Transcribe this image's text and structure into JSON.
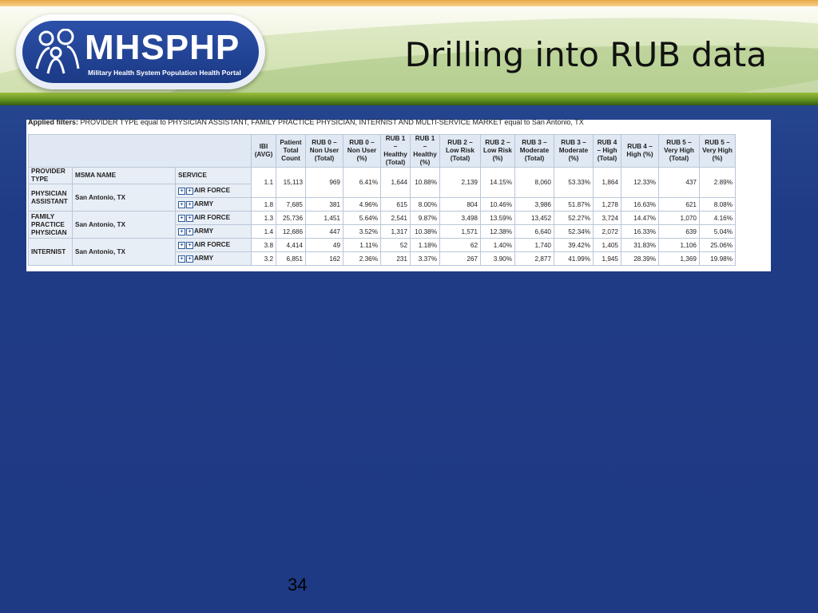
{
  "slide": {
    "title": "Drilling into RUB data",
    "page_number": "34"
  },
  "logo": {
    "brand": "MHSPHP",
    "tagline": "Military Health System Population Health Portal"
  },
  "filters": {
    "label": "Applied filters:",
    "text": "PROVIDER TYPE equal to PHYSICIAN ASSISTANT, FAMILY PRACTICE PHYSICIAN, INTERNIST AND MULTI-SERVICE MARKET equal to San Antonio, TX"
  },
  "table": {
    "dimension_headers": [
      "PROVIDER TYPE",
      "MSMA NAME",
      "SERVICE"
    ],
    "metric_headers": [
      "IBI (AVG)",
      "Patient Total Count",
      "RUB 0 – Non User (Total)",
      "RUB 0 – Non User (%)",
      "RUB 1 – Healthy (Total)",
      "RUB 1 – Healthy (%)",
      "RUB 2 – Low Risk (Total)",
      "RUB 2 – Low Risk (%)",
      "RUB 3 – Moderate (Total)",
      "RUB 3 – Moderate (%)",
      "RUB 4 – High (Total)",
      "RUB 4 – High (%)",
      "RUB 5 – Very High (Total)",
      "RUB 5 – Very High (%)"
    ],
    "groups": [
      {
        "provider_type": "PHYSICIAN ASSISTANT",
        "msma": "San Antonio, TX",
        "rows": [
          {
            "service": "AIR FORCE",
            "values": [
              "1.1",
              "15,113",
              "969",
              "6.41%",
              "1,644",
              "10.88%",
              "2,139",
              "14.15%",
              "8,060",
              "53.33%",
              "1,864",
              "12.33%",
              "437",
              "2.89%"
            ]
          },
          {
            "service": "ARMY",
            "values": [
              "1.8",
              "7,685",
              "381",
              "4.96%",
              "615",
              "8.00%",
              "804",
              "10.46%",
              "3,986",
              "51.87%",
              "1,278",
              "16.63%",
              "621",
              "8.08%"
            ]
          }
        ]
      },
      {
        "provider_type": "FAMILY PRACTICE PHYSICIAN",
        "msma": "San Antonio, TX",
        "rows": [
          {
            "service": "AIR FORCE",
            "values": [
              "1.3",
              "25,736",
              "1,451",
              "5.64%",
              "2,541",
              "9.87%",
              "3,498",
              "13.59%",
              "13,452",
              "52.27%",
              "3,724",
              "14.47%",
              "1,070",
              "4.16%"
            ]
          },
          {
            "service": "ARMY",
            "values": [
              "1.4",
              "12,686",
              "447",
              "3.52%",
              "1,317",
              "10.38%",
              "1,571",
              "12.38%",
              "6,640",
              "52.34%",
              "2,072",
              "16.33%",
              "639",
              "5.04%"
            ]
          }
        ]
      },
      {
        "provider_type": "INTERNIST",
        "msma": "San Antonio, TX",
        "rows": [
          {
            "service": "AIR FORCE",
            "values": [
              "3.8",
              "4,414",
              "49",
              "1.11%",
              "52",
              "1.18%",
              "62",
              "1.40%",
              "1,740",
              "39.42%",
              "1,405",
              "31.83%",
              "1,106",
              "25.06%"
            ]
          },
          {
            "service": "ARMY",
            "values": [
              "3.2",
              "6,851",
              "162",
              "2.36%",
              "231",
              "3.37%",
              "267",
              "3.90%",
              "2,877",
              "41.99%",
              "1,945",
              "28.39%",
              "1,369",
              "19.98%"
            ]
          }
        ]
      }
    ]
  }
}
